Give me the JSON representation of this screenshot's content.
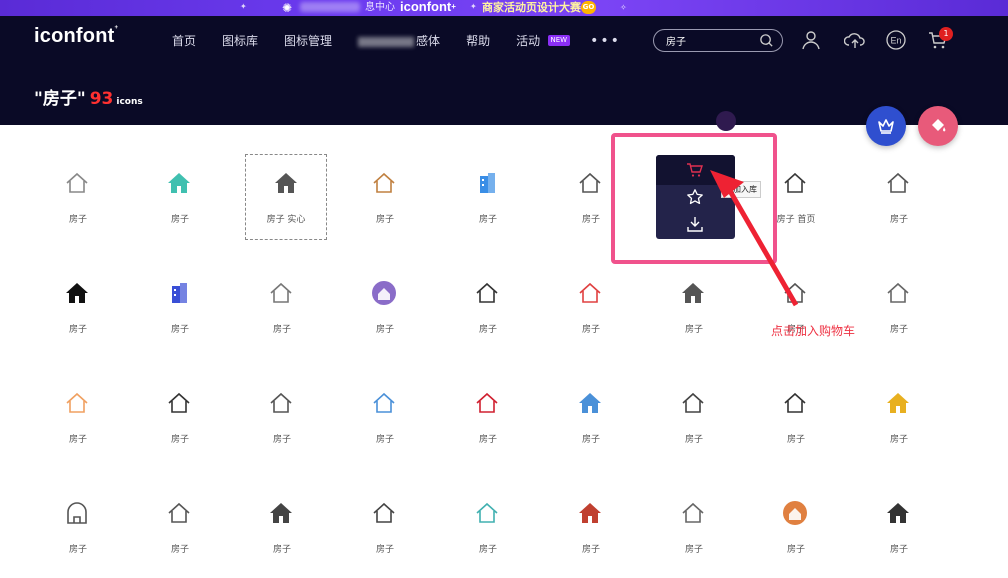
{
  "banner": {
    "small_text": "息中心",
    "brand": "iconfont",
    "brand_plus": "+",
    "promo": "商家活动页设计大赛",
    "go": "GO"
  },
  "header": {
    "logo": "iconfont",
    "logo_mark": "+",
    "nav": [
      {
        "label": "首页"
      },
      {
        "label": "图标库"
      },
      {
        "label": "图标管理"
      },
      {
        "label": "感体"
      },
      {
        "label": "帮助"
      },
      {
        "label": "活动",
        "badge": "NEW"
      }
    ],
    "more": "•••",
    "search_value": "房子",
    "lang": "En",
    "cart_count": "1"
  },
  "results": {
    "quote_title": "\"房子\"",
    "count": "93",
    "suffix": "icons"
  },
  "icons": [
    {
      "label": "房子",
      "icon": "house-outline-light-icon",
      "color": "#888888"
    },
    {
      "label": "房子",
      "icon": "house-teal-flat-icon",
      "color": "#40c0b0"
    },
    {
      "label": "房子 实心",
      "icon": "house-solid-icon",
      "color": "#555555"
    },
    {
      "label": "房子",
      "icon": "house-colorful-icon",
      "color": "#c08040"
    },
    {
      "label": "房子",
      "icon": "building-blue-icon",
      "color": "#3a8ee6"
    },
    {
      "label": "房子",
      "icon": "house-outline-icon",
      "color": "#555555"
    },
    {
      "label": "房子",
      "icon": "house-hover-icon",
      "color": "#555555"
    },
    {
      "label": "房子 首页",
      "icon": "house-green-door-icon",
      "color": "#3a3a3a"
    },
    {
      "label": "房子",
      "icon": "house-outline-thin-icon",
      "color": "#555555"
    },
    {
      "label": "房子",
      "icon": "house-black-solid-icon",
      "color": "#111111"
    },
    {
      "label": "房子",
      "icon": "building-purple-icon",
      "color": "#3a4fd6"
    },
    {
      "label": "房子",
      "icon": "house-outline-door-icon",
      "color": "#777777"
    },
    {
      "label": "房子",
      "icon": "house-purple-circle-icon",
      "color": "#8a6cc8"
    },
    {
      "label": "房子",
      "icon": "house-red-chimney-icon",
      "color": "#333333"
    },
    {
      "label": "房子",
      "icon": "house-red-roof-icon",
      "color": "#e04040"
    },
    {
      "label": "房子",
      "icon": "house-gray-solid-icon",
      "color": "#555555"
    },
    {
      "label": "房子",
      "icon": "house-outline-small-icon",
      "color": "#555555"
    },
    {
      "label": "房子",
      "icon": "house-outline-window-icon",
      "color": "#666666"
    },
    {
      "label": "房子",
      "icon": "house-orange-dashed-icon",
      "color": "#f0a060"
    },
    {
      "label": "房子",
      "icon": "house-outline-grid-icon",
      "color": "#333333"
    },
    {
      "label": "房子",
      "icon": "bank-outline-icon",
      "color": "#555555"
    },
    {
      "label": "房子",
      "icon": "house-blue-flag-icon",
      "color": "#4a90d8"
    },
    {
      "label": "房子",
      "icon": "house-red-tiny-icon",
      "color": "#d02030"
    },
    {
      "label": "房子",
      "icon": "house-blue-flat-icon",
      "color": "#4a90d8"
    },
    {
      "label": "房子",
      "icon": "house-outline-round-icon",
      "color": "#444444"
    },
    {
      "label": "房子",
      "icon": "house-outline-plain-icon",
      "color": "#333333"
    },
    {
      "label": "房子",
      "icon": "house-yellow-icon",
      "color": "#e8b020"
    },
    {
      "label": "房子",
      "icon": "arch-outline-icon",
      "color": "#555555"
    },
    {
      "label": "房子",
      "icon": "house-outline-mini-icon",
      "color": "#555555"
    },
    {
      "label": "房子",
      "icon": "house-dark-solid-icon",
      "color": "#444444"
    },
    {
      "label": "房子",
      "icon": "house-3d-outline-icon",
      "color": "#444444"
    },
    {
      "label": "房子",
      "icon": "house-heart-icon",
      "color": "#40b0b0"
    },
    {
      "label": "房子",
      "icon": "house-red-orange-icon",
      "color": "#c04030"
    },
    {
      "label": "房子",
      "icon": "house-outline-light2-icon",
      "color": "#666666"
    },
    {
      "label": "房子",
      "icon": "house-orange-circle-icon",
      "color": "#e08040"
    },
    {
      "label": "房子",
      "icon": "house-black-small-icon",
      "color": "#333333"
    }
  ],
  "hover": {
    "tooltip": "添加入库",
    "annotation": "点击加入购物车",
    "cart_color": "#e03050"
  },
  "colors": {
    "header_bg": "#0a0a26",
    "accent_red": "#ff3030",
    "highlight_pink": "#f0528c"
  }
}
